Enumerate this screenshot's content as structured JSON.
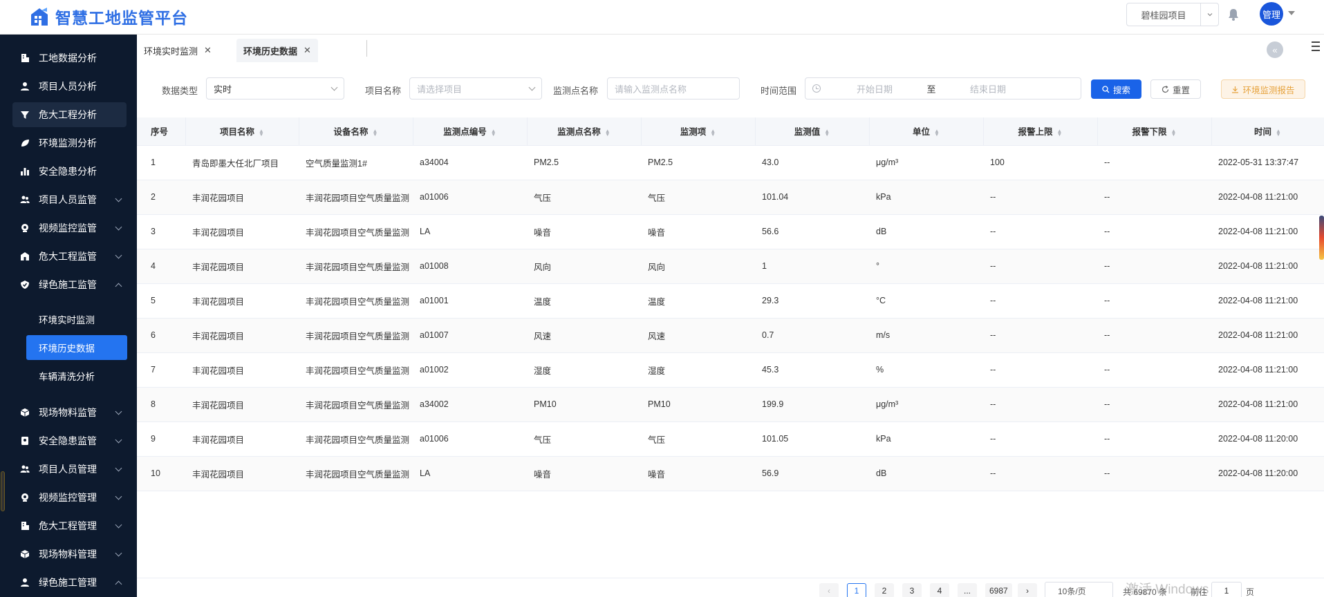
{
  "header": {
    "app_title": "智慧工地监管平台",
    "project_selected": "碧桂园项目",
    "user_label": "管理"
  },
  "sidebar": {
    "items": [
      {
        "label": "工地数据分析",
        "icon": "building-icon"
      },
      {
        "label": "项目人员分析",
        "icon": "person-icon"
      },
      {
        "label": "危大工程分析",
        "icon": "filter-icon"
      },
      {
        "label": "环境监测分析",
        "icon": "leaf-icon"
      },
      {
        "label": "安全隐患分析",
        "icon": "bar-chart-icon"
      },
      {
        "label": "项目人员监管",
        "icon": "people-icon"
      },
      {
        "label": "视频监控监管",
        "icon": "camera-icon"
      },
      {
        "label": "危大工程监管",
        "icon": "building-icon"
      },
      {
        "label": "绿色施工监管",
        "icon": "shield-check-icon"
      },
      {
        "label": "现场物料监管",
        "icon": "box-icon"
      },
      {
        "label": "安全隐患监管",
        "icon": "badge-icon"
      },
      {
        "label": "项目人员管理",
        "icon": "people-icon"
      },
      {
        "label": "视频监控管理",
        "icon": "camera-icon"
      },
      {
        "label": "危大工程管理",
        "icon": "building-icon"
      },
      {
        "label": "现场物料管理",
        "icon": "box-icon"
      },
      {
        "label": "绿色施工管理",
        "icon": "person-icon"
      }
    ],
    "sub_items": [
      "环境实时监测",
      "环境历史数据",
      "车辆清洗分析"
    ]
  },
  "tabs": [
    {
      "label": "环境实时监测"
    },
    {
      "label": "环境历史数据"
    }
  ],
  "filters": {
    "data_type_label": "数据类型",
    "data_type_value": "实时",
    "project_label": "项目名称",
    "project_placeholder": "请选择项目",
    "point_label": "监测点名称",
    "point_placeholder": "请输入监测点名称",
    "time_label": "时间范围",
    "start_placeholder": "开始日期",
    "range_sep": "至",
    "end_placeholder": "结束日期",
    "search_btn": "搜索",
    "reset_btn": "重置",
    "report_btn": "环境监测报告"
  },
  "table": {
    "columns": [
      "序号",
      "项目名称",
      "设备名称",
      "监测点编号",
      "监测点名称",
      "监测项",
      "监测值",
      "单位",
      "报警上限",
      "报警下限",
      "时间"
    ],
    "rows": [
      [
        "1",
        "青岛即墨大任北厂项目",
        "空气质量监测1#",
        "a34004",
        "PM2.5",
        "PM2.5",
        "43.0",
        "μg/m³",
        "100",
        "--",
        "2022-05-31 13:37:47"
      ],
      [
        "2",
        "丰润花园项目",
        "丰润花园项目空气质量监测",
        "a01006",
        "气压",
        "气压",
        "101.04",
        "kPa",
        "--",
        "--",
        "2022-04-08 11:21:00"
      ],
      [
        "3",
        "丰润花园项目",
        "丰润花园项目空气质量监测",
        "LA",
        "噪音",
        "噪音",
        "56.6",
        "dB",
        "--",
        "--",
        "2022-04-08 11:21:00"
      ],
      [
        "4",
        "丰润花园项目",
        "丰润花园项目空气质量监测",
        "a01008",
        "风向",
        "风向",
        "1",
        "°",
        "--",
        "--",
        "2022-04-08 11:21:00"
      ],
      [
        "5",
        "丰润花园项目",
        "丰润花园项目空气质量监测",
        "a01001",
        "温度",
        "温度",
        "29.3",
        "°C",
        "--",
        "--",
        "2022-04-08 11:21:00"
      ],
      [
        "6",
        "丰润花园项目",
        "丰润花园项目空气质量监测",
        "a01007",
        "风速",
        "风速",
        "0.7",
        "m/s",
        "--",
        "--",
        "2022-04-08 11:21:00"
      ],
      [
        "7",
        "丰润花园项目",
        "丰润花园项目空气质量监测",
        "a01002",
        "湿度",
        "湿度",
        "45.3",
        "%",
        "--",
        "--",
        "2022-04-08 11:21:00"
      ],
      [
        "8",
        "丰润花园项目",
        "丰润花园项目空气质量监测",
        "a34002",
        "PM10",
        "PM10",
        "199.9",
        "μg/m³",
        "--",
        "--",
        "2022-04-08 11:21:00"
      ],
      [
        "9",
        "丰润花园项目",
        "丰润花园项目空气质量监测",
        "a01006",
        "气压",
        "气压",
        "101.05",
        "kPa",
        "--",
        "--",
        "2022-04-08 11:20:00"
      ],
      [
        "10",
        "丰润花园项目",
        "丰润花园项目空气质量监测",
        "LA",
        "噪音",
        "噪音",
        "56.9",
        "dB",
        "--",
        "--",
        "2022-04-08 11:20:00"
      ]
    ]
  },
  "pagination": {
    "pages": [
      "1",
      "2",
      "3",
      "4",
      "...",
      "6987"
    ],
    "page_size": "10条/页",
    "total_text": "共 69870 条",
    "goto_label": "前往",
    "goto_value": "1",
    "page_unit": "页"
  },
  "watermark": "激活 Windows",
  "colors": {
    "primary": "#1a63e8",
    "sidebar_bg": "#0d1a2e",
    "active_sub": "#2474f0",
    "report": "#e6a23c"
  }
}
